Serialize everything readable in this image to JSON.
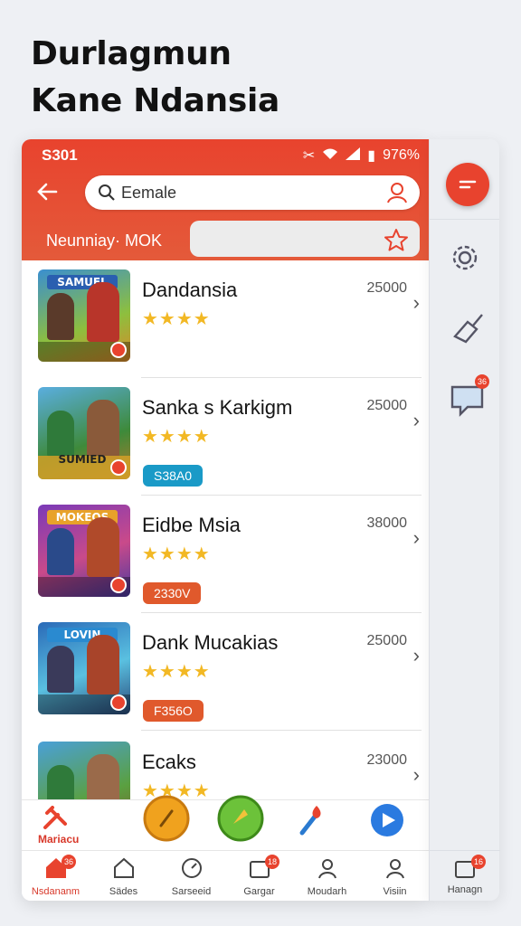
{
  "headline": {
    "line1": "Durlagmun",
    "line2": "Kane Ndansia"
  },
  "status": {
    "time": "S301",
    "battery": "976%"
  },
  "search": {
    "placeholder": "Eemale"
  },
  "subheader": {
    "label": "Neunniay· MOK"
  },
  "games": [
    {
      "title": "Dandansia",
      "price": "25000",
      "rating": "★★★★",
      "chip": "",
      "chip_color": "",
      "logo": "SAMUEL"
    },
    {
      "title": "Sanka s Karkigm",
      "price": "25000",
      "rating": "★★★★",
      "chip": "S38A0",
      "chip_color": "#1a9ac7",
      "logo": "SUMIED"
    },
    {
      "title": "Eidbe Msia",
      "price": "38000",
      "rating": "★★★★",
      "chip": "2330V",
      "chip_color": "#e0592c",
      "logo": "MOKEOS"
    },
    {
      "title": "Dank Mucakias",
      "price": "25000",
      "rating": "★★★★",
      "chip": "F356O",
      "chip_color": "#e0592c",
      "logo": "LOVIN"
    },
    {
      "title": "Ecaks",
      "price": "23000",
      "rating": "★★★★",
      "chip": "",
      "chip_color": "",
      "logo": ""
    }
  ],
  "actions": {
    "label": "Mariacu"
  },
  "nav": [
    {
      "label": "Nsdananm",
      "icon": "home-icon",
      "badge": "36"
    },
    {
      "label": "Sädes",
      "icon": "house-outline-icon",
      "badge": ""
    },
    {
      "label": "Sarseeid",
      "icon": "gauge-icon",
      "badge": ""
    },
    {
      "label": "Gargar",
      "icon": "calendar-icon",
      "badge": "18"
    },
    {
      "label": "Moudarh",
      "icon": "person-icon",
      "badge": ""
    },
    {
      "label": "Visiin",
      "icon": "profile-icon",
      "badge": ""
    }
  ],
  "rail": {
    "chat_badge": "36",
    "bottom_label": "Hanagn",
    "bottom_badge": "16"
  },
  "colors": {
    "accent": "#e8432e",
    "star": "#f2b824"
  }
}
